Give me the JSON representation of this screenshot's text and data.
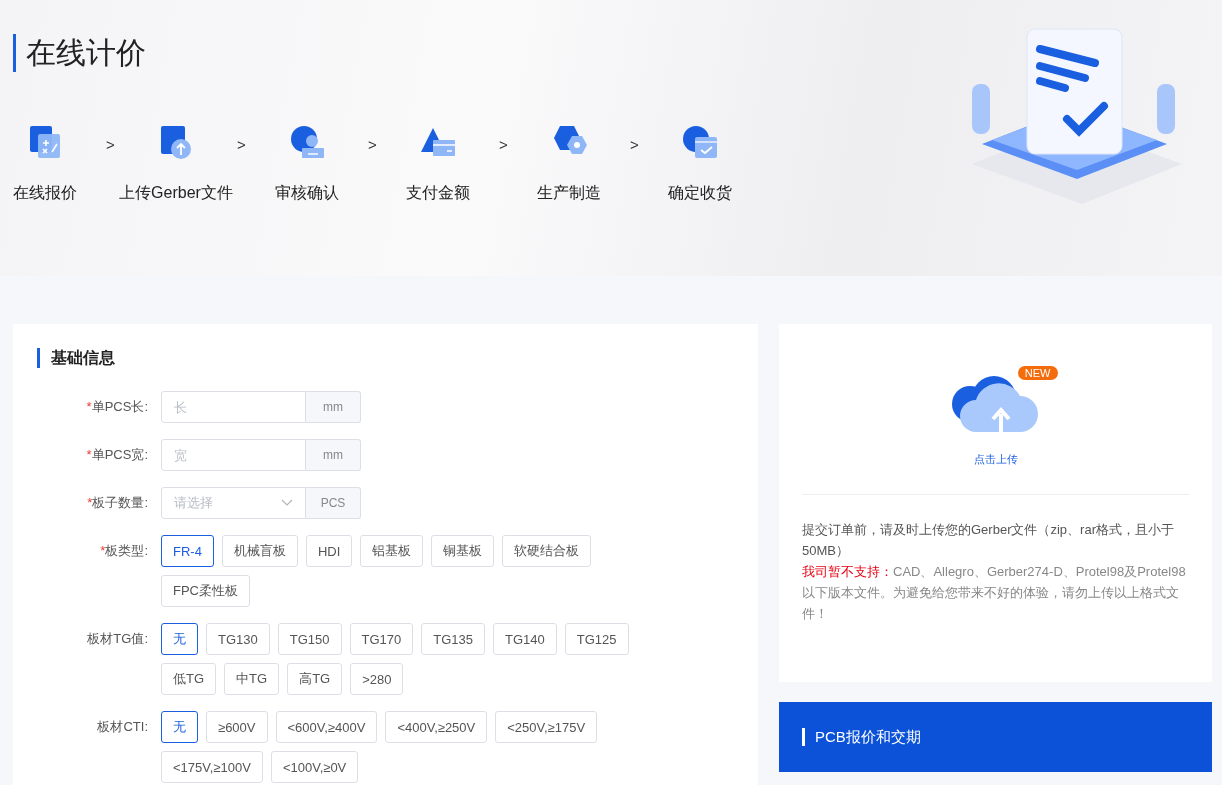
{
  "header": {
    "title": "在线计价",
    "steps": [
      {
        "label": "在线报价"
      },
      {
        "label": "上传Gerber文件"
      },
      {
        "label": "审核确认"
      },
      {
        "label": "支付金额"
      },
      {
        "label": "生产制造"
      },
      {
        "label": "确定收货"
      }
    ],
    "separator": ">"
  },
  "basic_info": {
    "title": "基础信息",
    "fields": [
      {
        "kind": "input",
        "required_mark": "*",
        "label": "单PCS长:",
        "placeholder": "长",
        "unit": "mm"
      },
      {
        "kind": "input",
        "required_mark": "*",
        "label": "单PCS宽:",
        "placeholder": "宽",
        "unit": "mm"
      },
      {
        "kind": "select",
        "required_mark": "*",
        "label": "板子数量:",
        "placeholder": "请选择",
        "unit": "PCS"
      },
      {
        "kind": "options",
        "required_mark": "*",
        "label": "板类型:",
        "options": [
          {
            "label": "FR-4",
            "selected": true
          },
          {
            "label": "机械盲板",
            "selected": false
          },
          {
            "label": "HDI",
            "selected": false
          },
          {
            "label": "铝基板",
            "selected": false
          },
          {
            "label": "铜基板",
            "selected": false
          },
          {
            "label": "软硬结合板",
            "selected": false
          },
          {
            "label": "FPC柔性板",
            "selected": false
          }
        ]
      },
      {
        "kind": "options",
        "label": "板材TG值:",
        "options": [
          {
            "label": "无",
            "selected": true
          },
          {
            "label": "TG130",
            "selected": false
          },
          {
            "label": "TG150",
            "selected": false
          },
          {
            "label": "TG170",
            "selected": false
          },
          {
            "label": "TG135",
            "selected": false
          },
          {
            "label": "TG140",
            "selected": false
          },
          {
            "label": "TG125",
            "selected": false
          },
          {
            "label": "低TG",
            "selected": false
          },
          {
            "label": "中TG",
            "selected": false
          },
          {
            "label": "高TG",
            "selected": false
          },
          {
            "label": ">280",
            "selected": false
          }
        ]
      },
      {
        "kind": "options",
        "label": "板材CTI:",
        "options": [
          {
            "label": "无",
            "selected": true
          },
          {
            "label": "≥600V",
            "selected": false
          },
          {
            "label": "<600V,≥400V",
            "selected": false
          },
          {
            "label": "<400V,≥250V",
            "selected": false
          },
          {
            "label": "<250V,≥175V",
            "selected": false
          },
          {
            "label": "<175V,≥100V",
            "selected": false
          },
          {
            "label": "<100V,≥0V",
            "selected": false
          }
        ]
      }
    ]
  },
  "upload": {
    "badge": "NEW",
    "link": "点击上传",
    "note": "提交订单前，请及时上传您的Gerber文件（zip、rar格式，且小于50MB）",
    "warning_lead": "我司暂不支持：",
    "warning_text": "CAD、Allegro、Gerber274-D、Protel98及Protel98以下版本文件。为避免给您带来不好的体验，请勿上传以上格式文件！"
  },
  "quote_panel": {
    "title": "PCB报价和交期"
  }
}
